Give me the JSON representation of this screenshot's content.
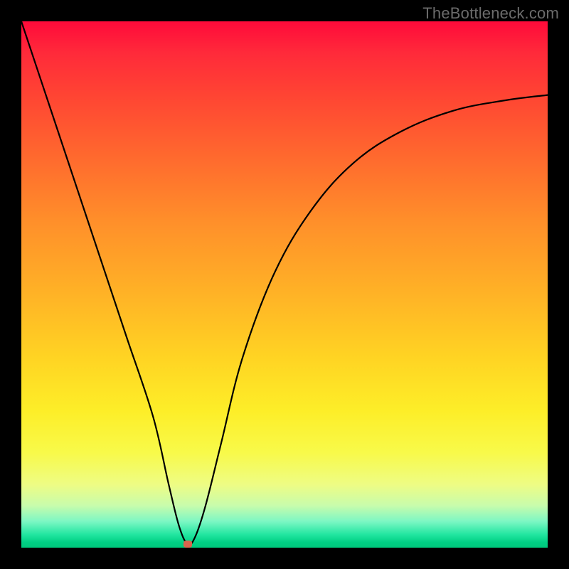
{
  "watermark": "TheBottleneck.com",
  "colors": {
    "frame": "#000000",
    "gradient_top": "#ff0a3a",
    "gradient_bottom": "#00c87c",
    "curve": "#000000",
    "min_marker": "#d9644e"
  },
  "chart_data": {
    "type": "line",
    "title": "",
    "xlabel": "",
    "ylabel": "",
    "xlim": [
      0,
      100
    ],
    "ylim": [
      0,
      100
    ],
    "grid": false,
    "legend": false,
    "annotations": [],
    "series": [
      {
        "name": "bottleneck-curve",
        "x": [
          0,
          5,
          10,
          15,
          20,
          25,
          28,
          30,
          31.6,
          33,
          35,
          38,
          42,
          48,
          55,
          63,
          72,
          82,
          92,
          100
        ],
        "values": [
          100,
          85,
          70,
          55,
          40,
          25,
          12,
          4,
          0.7,
          2,
          8,
          20,
          36,
          52,
          64,
          73,
          79,
          83,
          85,
          86
        ]
      }
    ],
    "min_point": {
      "x": 31.6,
      "y": 0.7
    }
  }
}
